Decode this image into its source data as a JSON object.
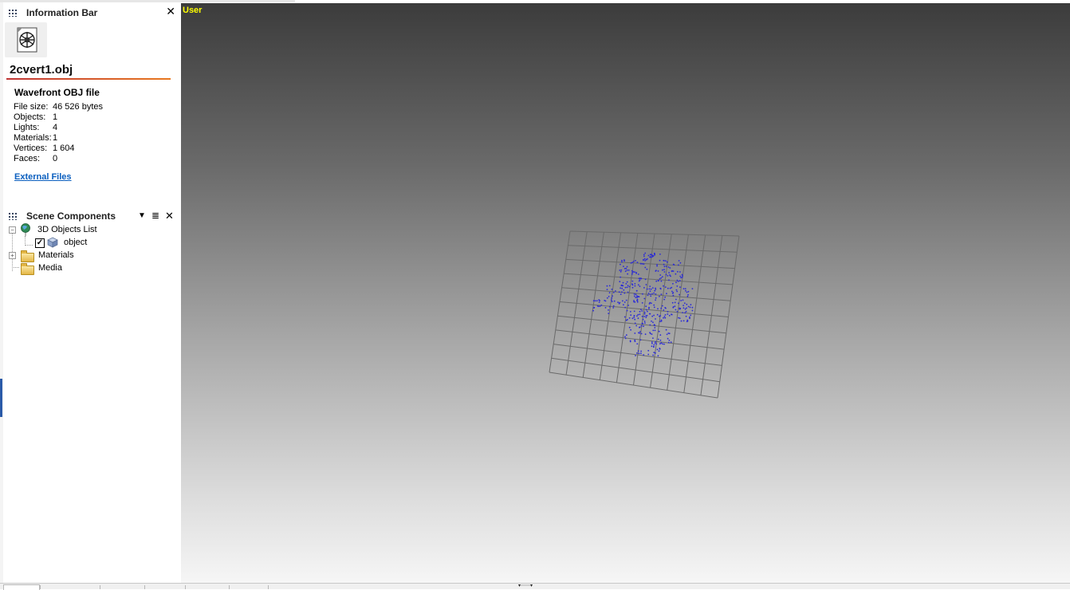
{
  "info_bar": {
    "title": "Information Bar",
    "close_glyph": "✕",
    "file_icon": "3d-file-icon",
    "filename": "2cvert1.obj",
    "file_type": "Wavefront OBJ file",
    "stats": [
      {
        "label": "File size:",
        "value": "46 526 bytes"
      },
      {
        "label": "Objects:",
        "value": "1"
      },
      {
        "label": "Lights:",
        "value": "4"
      },
      {
        "label": "Materials:",
        "value": "1"
      },
      {
        "label": "Vertices:",
        "value": "1 604"
      },
      {
        "label": "Faces:",
        "value": "0"
      }
    ],
    "external_files_link": "External Files",
    "accent_colors": [
      "#c03434",
      "#e8781f"
    ]
  },
  "scene_components": {
    "title": "Scene Components",
    "dropdown_glyph": "▼",
    "list_glyph": "≣",
    "close_glyph": "✕",
    "tree": {
      "objects_list": {
        "label": "3D Objects List",
        "icon": "globe-icon",
        "expander": "−"
      },
      "object": {
        "label": "object",
        "checked": true,
        "icon": "cube-icon"
      },
      "materials": {
        "label": "Materials",
        "icon": "folder-icon",
        "expander": "+"
      },
      "media": {
        "label": "Media",
        "icon": "folder-icon"
      }
    }
  },
  "viewport": {
    "label": "User",
    "label_color": "#ffff00",
    "point_color": "#2a2ad8",
    "grid_color": "#6a6a6a"
  },
  "bottom_bar": {
    "splitter_glyph": "▾⋯⋯▾"
  }
}
